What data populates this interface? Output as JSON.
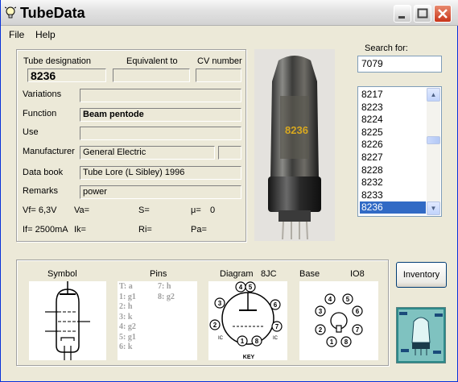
{
  "window": {
    "title": "TubeData"
  },
  "menu": {
    "file": "File",
    "help": "Help"
  },
  "labels": {
    "tube_designation": "Tube designation",
    "equivalent_to": "Equivalent to",
    "cv_number": "CV number",
    "variations": "Variations",
    "function": "Function",
    "use": "Use",
    "manufacturer": "Manufacturer",
    "data_book": "Data book",
    "remarks": "Remarks"
  },
  "fields": {
    "tube_designation": "8236",
    "equivalent_to": "",
    "cv_number": "",
    "variations": "",
    "function": "Beam pentode",
    "use": "",
    "manufacturer": "General Electric",
    "manufacturer_code": "",
    "data_book": "Tube Lore (L Sibley) 1996",
    "remarks": "power"
  },
  "params": {
    "vf": "Vf= 6,3V",
    "va": "Va=",
    "s": "S=",
    "mu": "μ=",
    "mu_value": "0",
    "if": "If= 2500mA",
    "ik": "Ik=",
    "ri": "Ri=",
    "pa": "Pa="
  },
  "photo": {
    "print": "8236"
  },
  "search": {
    "label": "Search for:",
    "value": "7079"
  },
  "tube_list": [
    "8217",
    "8223",
    "8224",
    "8225",
    "8226",
    "8227",
    "8228",
    "8232",
    "8233",
    "8236"
  ],
  "selected_tube": "8236",
  "bottom": {
    "symbol": "Symbol",
    "pins": "Pins",
    "diagram": "Diagram",
    "diagram_code": "8JC",
    "base": "Base",
    "base_code": "IO8",
    "key": "KEY",
    "ic1": "IC",
    "ic2": "IC"
  },
  "pins_col1": [
    "T: a",
    "1: g1",
    "2: h",
    "3: k",
    "4: g2",
    "5: g1",
    "6: k"
  ],
  "pins_col2": [
    "7: h",
    "8: g2"
  ],
  "diagram_pins": [
    "3",
    "4",
    "5",
    "6",
    "7",
    "8",
    "2",
    "1"
  ],
  "base_pins": [
    "4",
    "5",
    "3",
    "6",
    "2",
    "7",
    "1",
    "8"
  ],
  "inventory_button": "Inventory",
  "colors": {
    "title_bar": "#e3e3e3",
    "selection": "#316ac5",
    "close_button": "#c8341a",
    "logo_bg": "#2e8a8a"
  }
}
